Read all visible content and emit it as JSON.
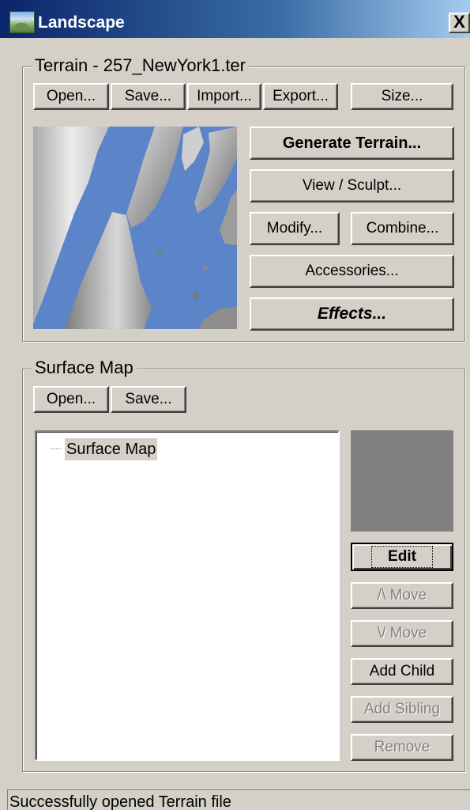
{
  "window": {
    "title": "Landscape",
    "close_glyph": "X",
    "app_icon": "landscape-app-icon"
  },
  "terrain": {
    "group_label": "Terrain - 257_NewYork1.ter",
    "buttons": {
      "open": "Open...",
      "save": "Save...",
      "import": "Import...",
      "export": "Export...",
      "size": "Size...",
      "generate": "Generate Terrain...",
      "view_sculpt": "View / Sculpt...",
      "modify": "Modify...",
      "combine": "Combine...",
      "accessories": "Accessories...",
      "effects": "Effects..."
    },
    "colors": {
      "water": "#5b84c9",
      "land_light": "#e6e6e6",
      "land_dark": "#7a7a7a"
    }
  },
  "surface_map": {
    "group_label": "Surface Map",
    "buttons": {
      "open": "Open...",
      "save": "Save...",
      "edit": "Edit",
      "move_up": "/\\ Move",
      "move_down": "\\/ Move",
      "add_child": "Add Child",
      "add_sibling": "Add Sibling",
      "remove": "Remove"
    },
    "tree": [
      {
        "label": "Surface Map"
      }
    ],
    "preview_color": "#808080"
  },
  "status": {
    "text": "Successfully opened Terrain file"
  }
}
